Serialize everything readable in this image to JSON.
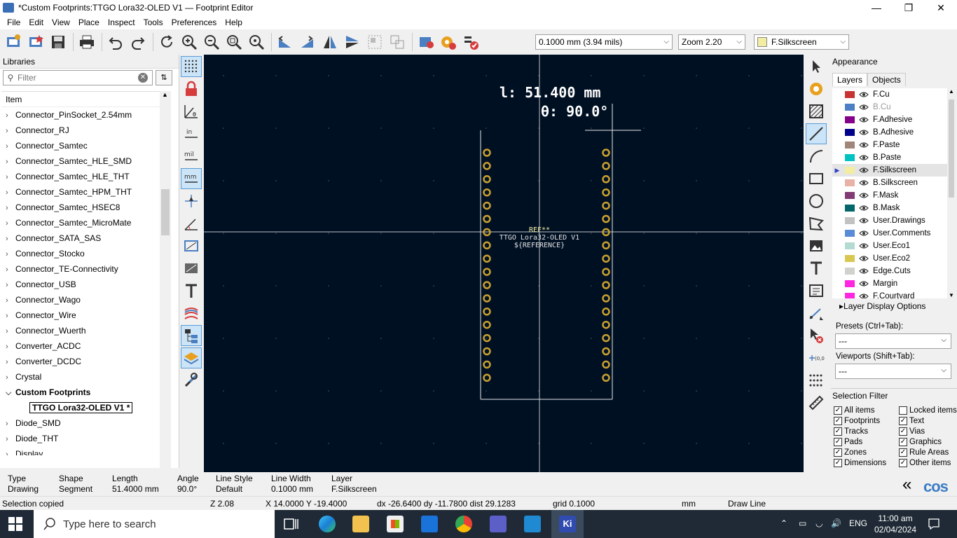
{
  "window": {
    "title": "*Custom Footprints:TTGO Lora32-OLED V1 — Footprint Editor",
    "minimize": "—",
    "restore": "❐",
    "close": "✕"
  },
  "menu": [
    "File",
    "Edit",
    "View",
    "Place",
    "Inspect",
    "Tools",
    "Preferences",
    "Help"
  ],
  "toolbar": {
    "grid_value": "0.1000 mm (3.94 mils)",
    "zoom_value": "Zoom 2.20",
    "layer_value": "F.Silkscreen",
    "layer_color": "#f2eda1"
  },
  "libraries": {
    "heading": "Libraries",
    "filter_placeholder": "Filter",
    "column_header": "Item",
    "items": [
      {
        "label": "Connector_PinSocket_2.54mm",
        "expanded": false
      },
      {
        "label": "Connector_RJ",
        "expanded": false
      },
      {
        "label": "Connector_Samtec",
        "expanded": false
      },
      {
        "label": "Connector_Samtec_HLE_SMD",
        "expanded": false
      },
      {
        "label": "Connector_Samtec_HLE_THT",
        "expanded": false
      },
      {
        "label": "Connector_Samtec_HPM_THT",
        "expanded": false
      },
      {
        "label": "Connector_Samtec_HSEC8",
        "expanded": false
      },
      {
        "label": "Connector_Samtec_MicroMate",
        "expanded": false
      },
      {
        "label": "Connector_SATA_SAS",
        "expanded": false
      },
      {
        "label": "Connector_Stocko",
        "expanded": false
      },
      {
        "label": "Connector_TE-Connectivity",
        "expanded": false
      },
      {
        "label": "Connector_USB",
        "expanded": false
      },
      {
        "label": "Connector_Wago",
        "expanded": false
      },
      {
        "label": "Connector_Wire",
        "expanded": false
      },
      {
        "label": "Connector_Wuerth",
        "expanded": false
      },
      {
        "label": "Converter_ACDC",
        "expanded": false
      },
      {
        "label": "Converter_DCDC",
        "expanded": false
      },
      {
        "label": "Crystal",
        "expanded": false
      },
      {
        "label": "Custom Footprints",
        "expanded": true
      },
      {
        "label": "TTGO Lora32-OLED V1 *",
        "selected": true
      },
      {
        "label": "Diode_SMD",
        "expanded": false
      },
      {
        "label": "Diode_THT",
        "expanded": false
      },
      {
        "label": "Display",
        "expanded": false
      }
    ]
  },
  "canvas": {
    "length_readout": "l: 51.400 mm",
    "angle_readout": "θ: 90.0°",
    "ref_text": "REF**",
    "value_text": "TTGO Lora32-OLED V1",
    "reference_text": "${REFERENCE}",
    "background": "#001023",
    "pad_color": "#c8a030",
    "silk_color": "#f2eda1",
    "pads_per_side": 18
  },
  "appearance": {
    "heading": "Appearance",
    "tabs": [
      "Layers",
      "Objects"
    ],
    "layers": [
      {
        "name": "F.Cu",
        "color": "#c83434",
        "dim": false
      },
      {
        "name": "B.Cu",
        "color": "#4d7fc4",
        "dim": true
      },
      {
        "name": "F.Adhesive",
        "color": "#84008a",
        "dim": false
      },
      {
        "name": "B.Adhesive",
        "color": "#00008a",
        "dim": false
      },
      {
        "name": "F.Paste",
        "color": "#a0877a",
        "dim": false
      },
      {
        "name": "B.Paste",
        "color": "#00c2c2",
        "dim": false
      },
      {
        "name": "F.Silkscreen",
        "color": "#f2eda1",
        "dim": false,
        "selected": true
      },
      {
        "name": "B.Silkscreen",
        "color": "#e8b2a7",
        "dim": false
      },
      {
        "name": "F.Mask",
        "color": "#833b73",
        "dim": false
      },
      {
        "name": "B.Mask",
        "color": "#02666b",
        "dim": false
      },
      {
        "name": "User.Drawings",
        "color": "#c2c2c2",
        "dim": false
      },
      {
        "name": "User.Comments",
        "color": "#598bd6",
        "dim": false
      },
      {
        "name": "User.Eco1",
        "color": "#b4dbd2",
        "dim": false
      },
      {
        "name": "User.Eco2",
        "color": "#d8c852",
        "dim": false
      },
      {
        "name": "Edge.Cuts",
        "color": "#d0d2cd",
        "dim": false
      },
      {
        "name": "Margin",
        "color": "#ff26e2",
        "dim": false
      },
      {
        "name": "F.Courtyard",
        "color": "#ff26e2",
        "dim": false
      }
    ],
    "layer_display_options": "Layer Display Options",
    "presets_label": "Presets (Ctrl+Tab):",
    "presets_value": "---",
    "viewports_label": "Viewports (Shift+Tab):",
    "viewports_value": "---"
  },
  "selection_filter": {
    "heading": "Selection Filter",
    "items": [
      {
        "label": "All items",
        "checked": true
      },
      {
        "label": "Locked items",
        "checked": false
      },
      {
        "label": "Footprints",
        "checked": true
      },
      {
        "label": "Text",
        "checked": true
      },
      {
        "label": "Tracks",
        "checked": true
      },
      {
        "label": "Vias",
        "checked": true
      },
      {
        "label": "Pads",
        "checked": true
      },
      {
        "label": "Graphics",
        "checked": true
      },
      {
        "label": "Zones",
        "checked": true
      },
      {
        "label": "Rule Areas",
        "checked": true
      },
      {
        "label": "Dimensions",
        "checked": true
      },
      {
        "label": "Other items",
        "checked": true
      }
    ]
  },
  "message_panel": {
    "type_label": "Type",
    "type_value": "Drawing",
    "shape_label": "Shape",
    "shape_value": "Segment",
    "length_label": "Length",
    "length_value": "51.4000 mm",
    "angle_label": "Angle",
    "angle_value": "90.0°",
    "linestyle_label": "Line Style",
    "linestyle_value": "Default",
    "linewidth_label": "Line Width",
    "linewidth_value": "0.1000 mm",
    "layer_label": "Layer",
    "layer_value": "F.Silkscreen",
    "collapse": "«",
    "logo_text": "cos"
  },
  "status": {
    "message": "Selection copied",
    "zoom": "Z 2.08",
    "coords": "X 14.0000  Y -19.4000",
    "delta": "dx -26.6400  dy -11.7800  dist 29.1283",
    "grid": "grid 0.1000",
    "units": "mm",
    "mode": "Draw Line"
  },
  "taskbar": {
    "search_placeholder": "Type here to search",
    "language": "ENG",
    "time": "11:00 am",
    "date": "02/04/2024"
  }
}
